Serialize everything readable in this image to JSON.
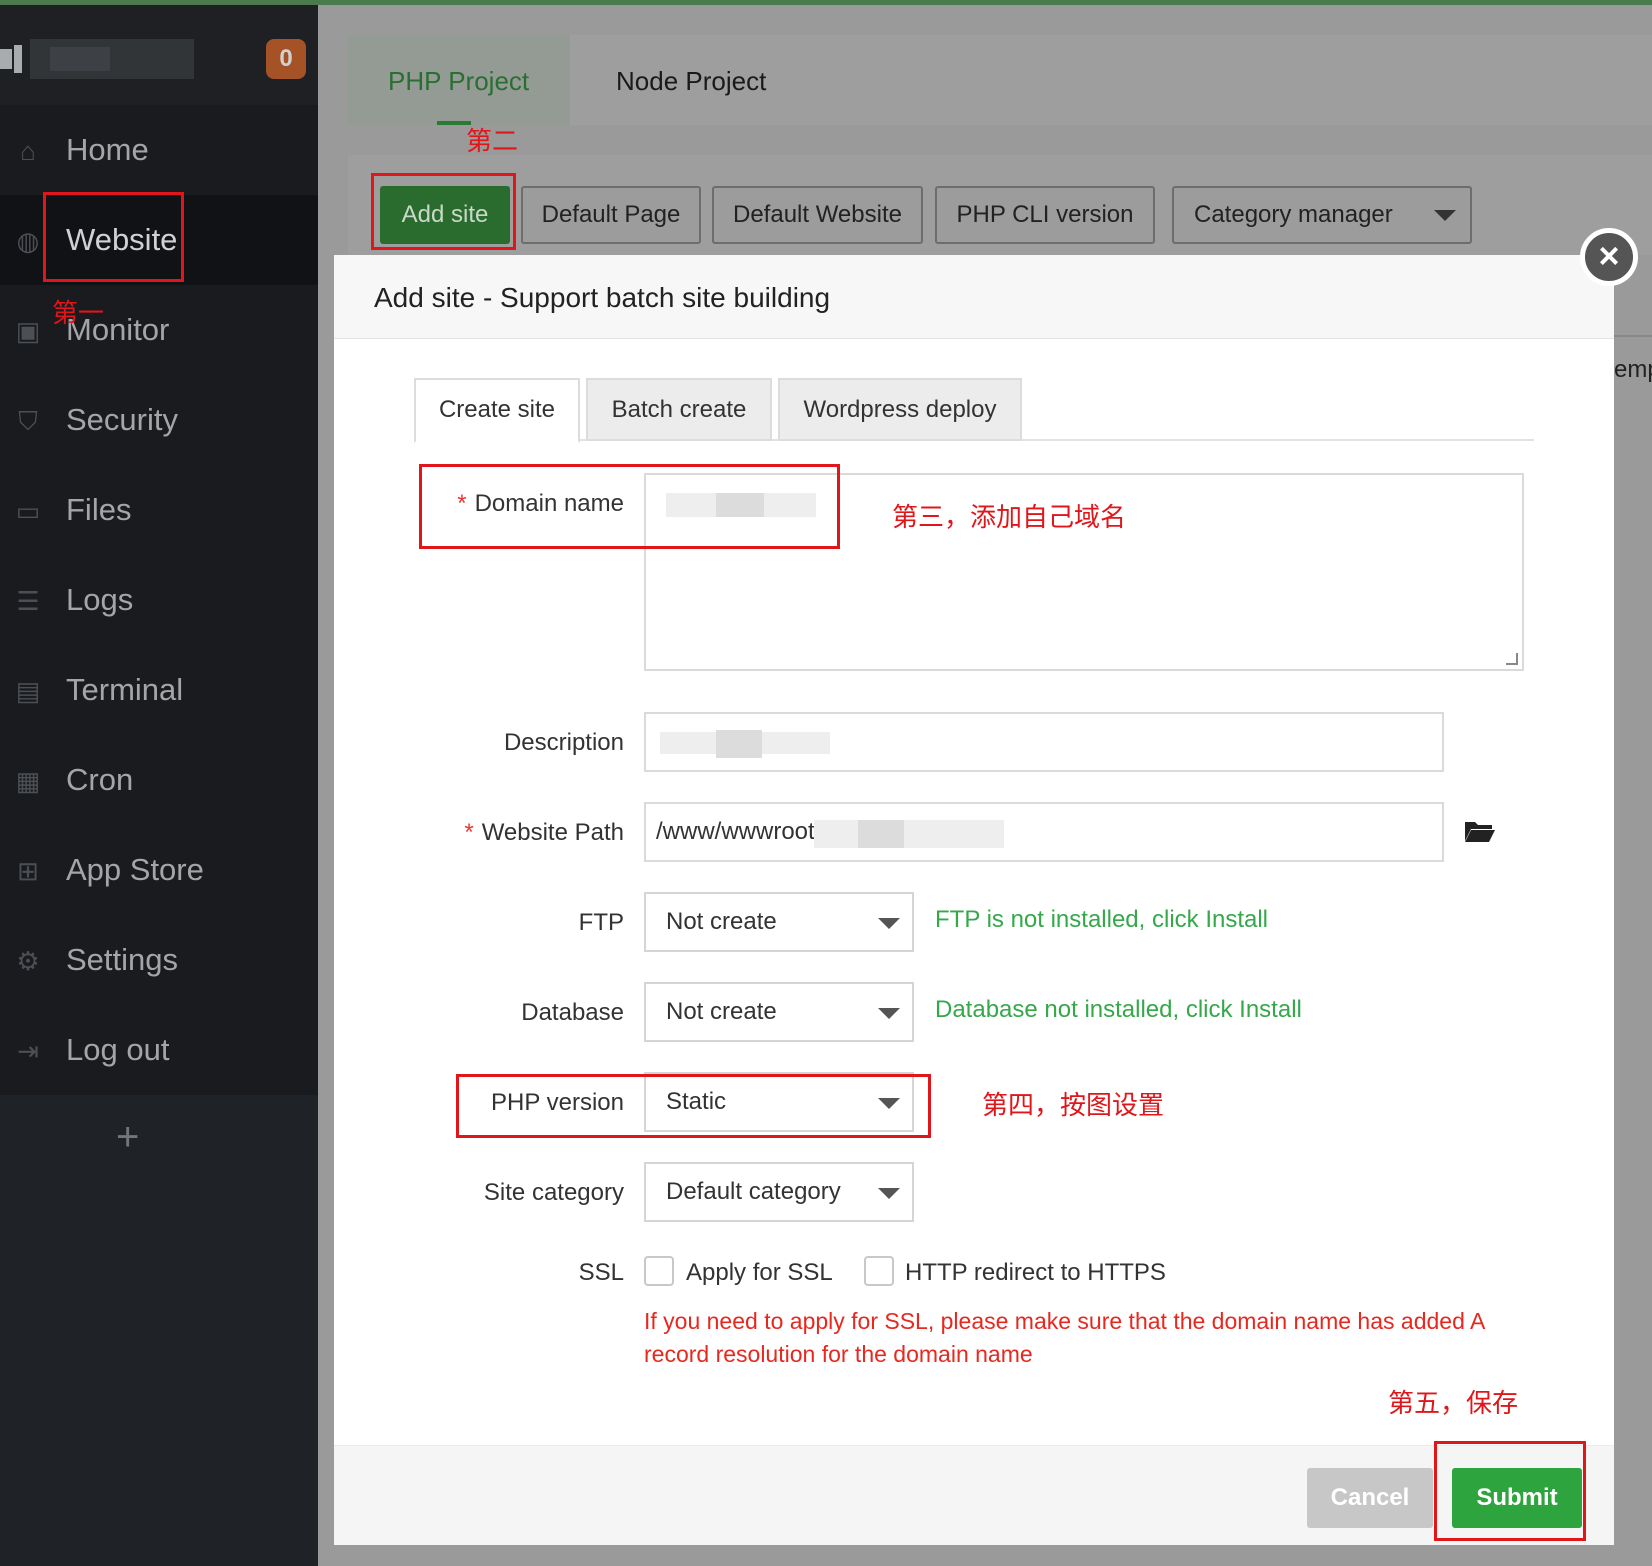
{
  "sidebar": {
    "badge_count": "0",
    "items": [
      {
        "label": "Home",
        "icon": "home-icon"
      },
      {
        "label": "Website",
        "icon": "globe-icon"
      },
      {
        "label": "Monitor",
        "icon": "monitor-icon"
      },
      {
        "label": "Security",
        "icon": "shield-icon"
      },
      {
        "label": "Files",
        "icon": "folder-icon"
      },
      {
        "label": "Logs",
        "icon": "log-icon"
      },
      {
        "label": "Terminal",
        "icon": "terminal-icon"
      },
      {
        "label": "Cron",
        "icon": "calendar-icon"
      },
      {
        "label": "App Store",
        "icon": "grid-icon"
      },
      {
        "label": "Settings",
        "icon": "gear-icon"
      },
      {
        "label": "Log out",
        "icon": "logout-icon"
      }
    ],
    "add_label": "+"
  },
  "project_tabs": {
    "php": "PHP Project",
    "node": "Node Project"
  },
  "toolbar": {
    "add_site": "Add site",
    "default_page": "Default Page",
    "default_website": "Default Website",
    "php_cli_version": "PHP CLI version",
    "category_manager": "Category manager"
  },
  "background": {
    "partial_text": "emp"
  },
  "modal": {
    "title": "Add site - Support batch site building",
    "close": "×",
    "tabs": [
      "Create site",
      "Batch create",
      "Wordpress deploy"
    ],
    "required_mark": "*",
    "labels": {
      "domain_name": "Domain name",
      "description": "Description",
      "website_path": "Website Path",
      "ftp": "FTP",
      "database": "Database",
      "php_version": "PHP version",
      "site_category": "Site category",
      "ssl": "SSL"
    },
    "website_path_value": "/www/wwwroot",
    "ftp_value": "Not create",
    "database_value": "Not create",
    "php_version_value": "Static",
    "site_category_value": "Default category",
    "ftp_note": "FTP is not installed, click Install",
    "database_note": "Database not installed, click Install",
    "ssl_apply_label": "Apply for SSL",
    "ssl_redirect_label": "HTTP redirect to HTTPS",
    "ssl_note": "If you need to apply for SSL, please make sure that the domain name has added A record resolution for the domain name",
    "cancel": "Cancel",
    "submit": "Submit"
  },
  "annotations": {
    "step1": "第一",
    "step2": "第二",
    "step3": "第三，添加自己域名",
    "step4": "第四，按图设置",
    "step5": "第五，保存"
  },
  "colors": {
    "accent_green": "#2ea43e",
    "annotation_red": "#e0161b",
    "note_green": "#35a84a",
    "ssl_note_red": "#e8281f"
  }
}
